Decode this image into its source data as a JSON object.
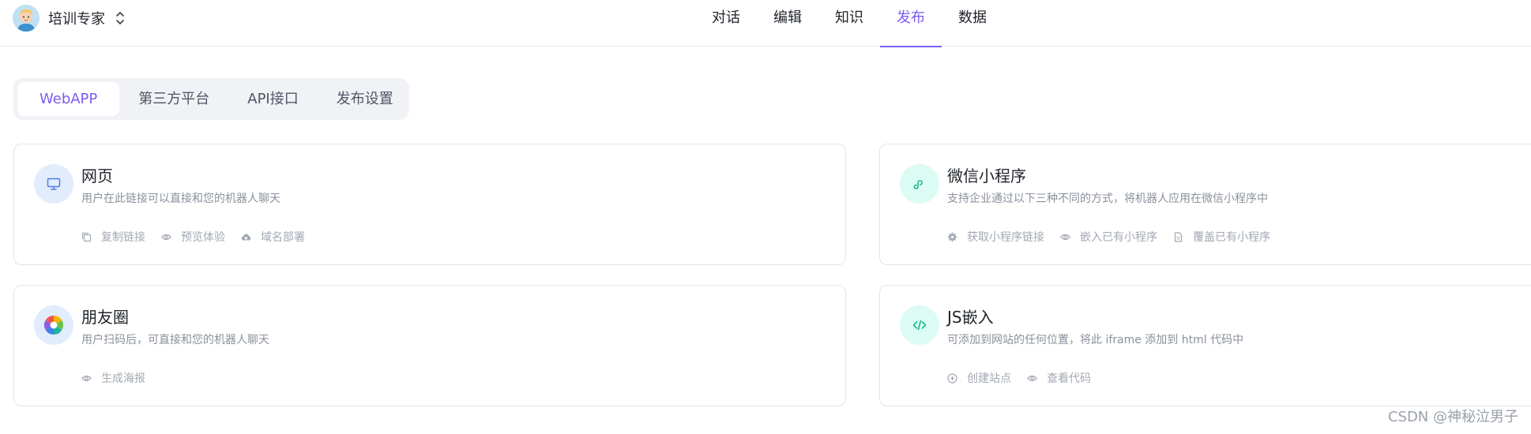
{
  "header": {
    "app_name": "培训专家",
    "nav": [
      {
        "label": "对话",
        "active": false
      },
      {
        "label": "编辑",
        "active": false
      },
      {
        "label": "知识",
        "active": false
      },
      {
        "label": "发布",
        "active": true
      },
      {
        "label": "数据",
        "active": false
      }
    ]
  },
  "tabs": [
    {
      "label": "WebAPP",
      "active": true
    },
    {
      "label": "第三方平台",
      "active": false
    },
    {
      "label": "API接口",
      "active": false
    },
    {
      "label": "发布设置",
      "active": false
    }
  ],
  "cards": [
    {
      "title": "网页",
      "description": "用户在此链接可以直接和您的机器人聊天",
      "icon": "monitor-icon",
      "actions": [
        {
          "label": "复制链接",
          "icon": "copy-icon"
        },
        {
          "label": "预览体验",
          "icon": "eye-icon"
        },
        {
          "label": "域名部署",
          "icon": "cloud-upload-icon"
        }
      ]
    },
    {
      "title": "微信小程序",
      "description": "支持企业通过以下三种不同的方式，将机器人应用在微信小程序中",
      "icon": "mini-program-icon",
      "actions": [
        {
          "label": "获取小程序链接",
          "icon": "gear-icon"
        },
        {
          "label": "嵌入已有小程序",
          "icon": "eye-icon"
        },
        {
          "label": "覆盖已有小程序",
          "icon": "document-icon"
        }
      ]
    },
    {
      "title": "朋友圈",
      "description": "用户扫码后，可直接和您的机器人聊天",
      "icon": "moments-icon",
      "actions": [
        {
          "label": "生成海报",
          "icon": "eye-icon"
        }
      ]
    },
    {
      "title": "JS嵌入",
      "description": "可添加到网站的任何位置，将此 iframe 添加到 html 代码中",
      "icon": "code-icon",
      "actions": [
        {
          "label": "创建站点",
          "icon": "plus-circle-icon"
        },
        {
          "label": "查看代码",
          "icon": "eye-icon"
        }
      ]
    }
  ],
  "watermark": "CSDN @神秘泣男子",
  "colors": {
    "accent": "#7b5cf0",
    "blue_icon_bg": "#e1ecfd",
    "green_icon_bg": "#dcfbf4",
    "text_muted": "#8a909c"
  }
}
